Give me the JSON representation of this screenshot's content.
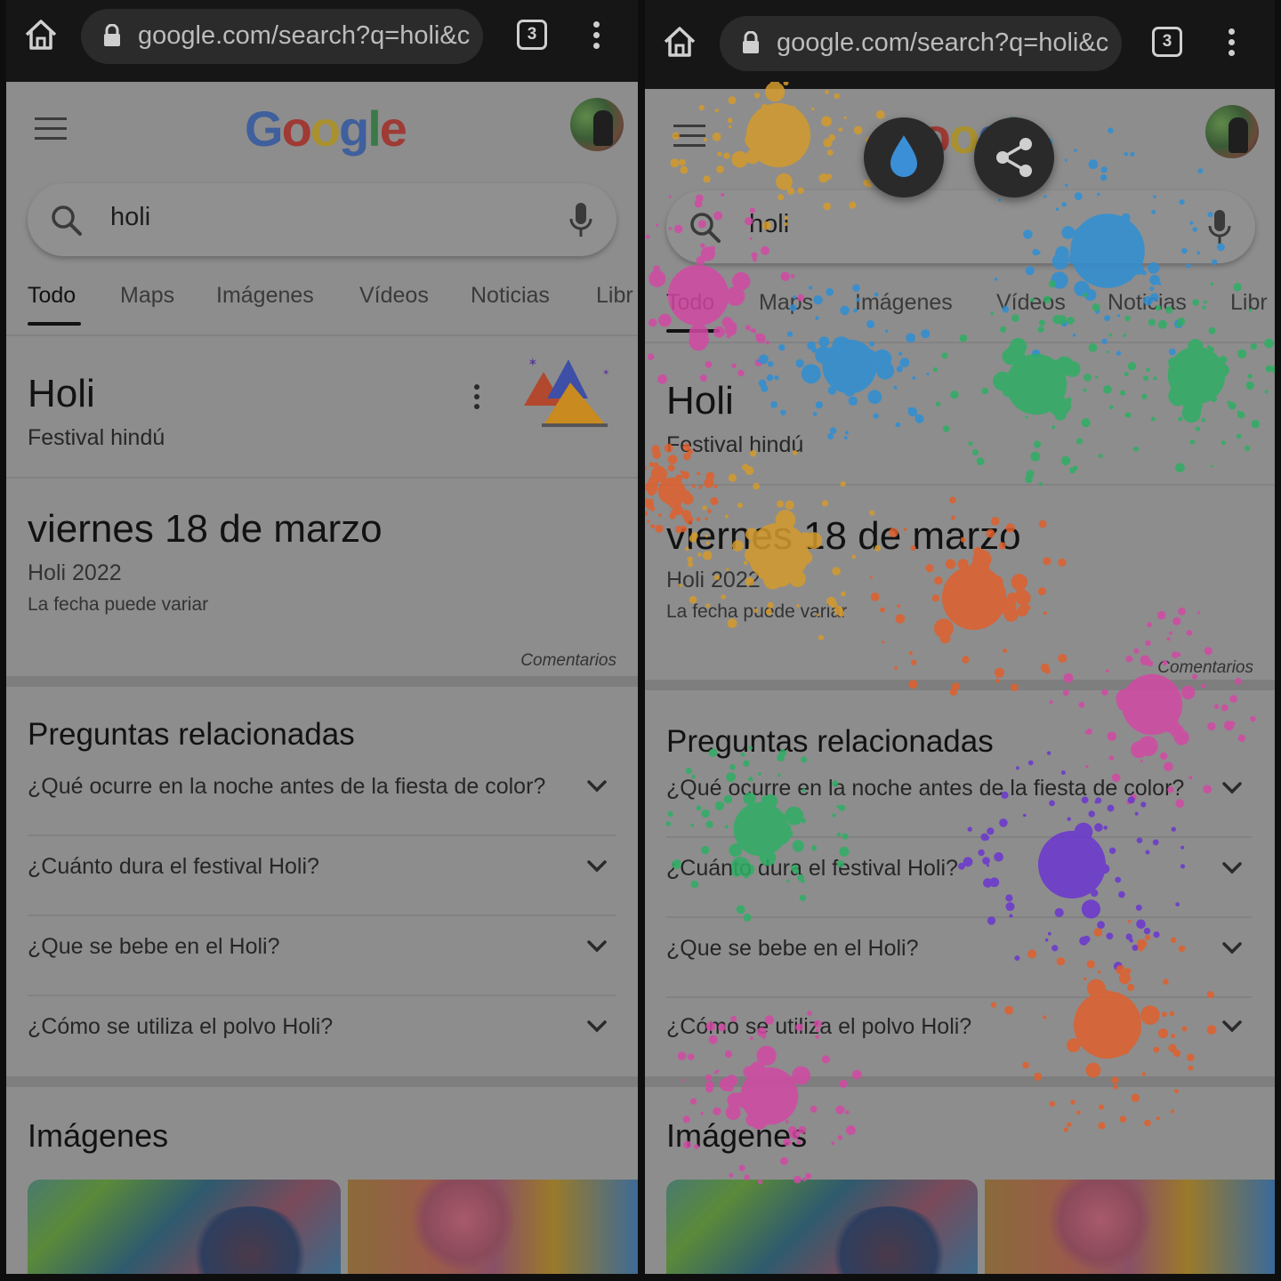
{
  "browser": {
    "url": "google.com/search?q=holi&c",
    "tab_count": "3"
  },
  "search": {
    "query": "holi"
  },
  "tabs": [
    {
      "label": "Todo"
    },
    {
      "label": "Maps"
    },
    {
      "label": "Imágenes"
    },
    {
      "label": "Vídeos"
    },
    {
      "label": "Noticias"
    },
    {
      "label": "Libr"
    }
  ],
  "knowledge": {
    "title": "Holi",
    "subtitle": "Festival hindú"
  },
  "date_card": {
    "date": "viernes 18 de marzo",
    "year_label": "Holi 2022",
    "note": "La fecha puede variar",
    "feedback": "Comentarios"
  },
  "related": {
    "title": "Preguntas relacionadas",
    "questions": [
      "¿Qué ocurre en la noche antes de la fiesta de color?",
      "¿Cuánto dura el festival Holi?",
      "¿Que se bebe en el Holi?",
      "¿Cómo se utiliza el polvo Holi?"
    ]
  },
  "images_section": {
    "title": "Imágenes"
  },
  "colors": {
    "splash": [
      "#d49b2c",
      "#d24aa4",
      "#2f8fd4",
      "#2fae64",
      "#e0602c",
      "#6a36d0"
    ]
  },
  "icons": [
    "home-icon",
    "lock-icon",
    "tabs-counter-icon",
    "overflow-menu-icon",
    "hamburger-icon",
    "search-icon",
    "mic-icon",
    "more-vert-icon",
    "chevron-down-icon",
    "water-drop-icon",
    "share-icon"
  ]
}
